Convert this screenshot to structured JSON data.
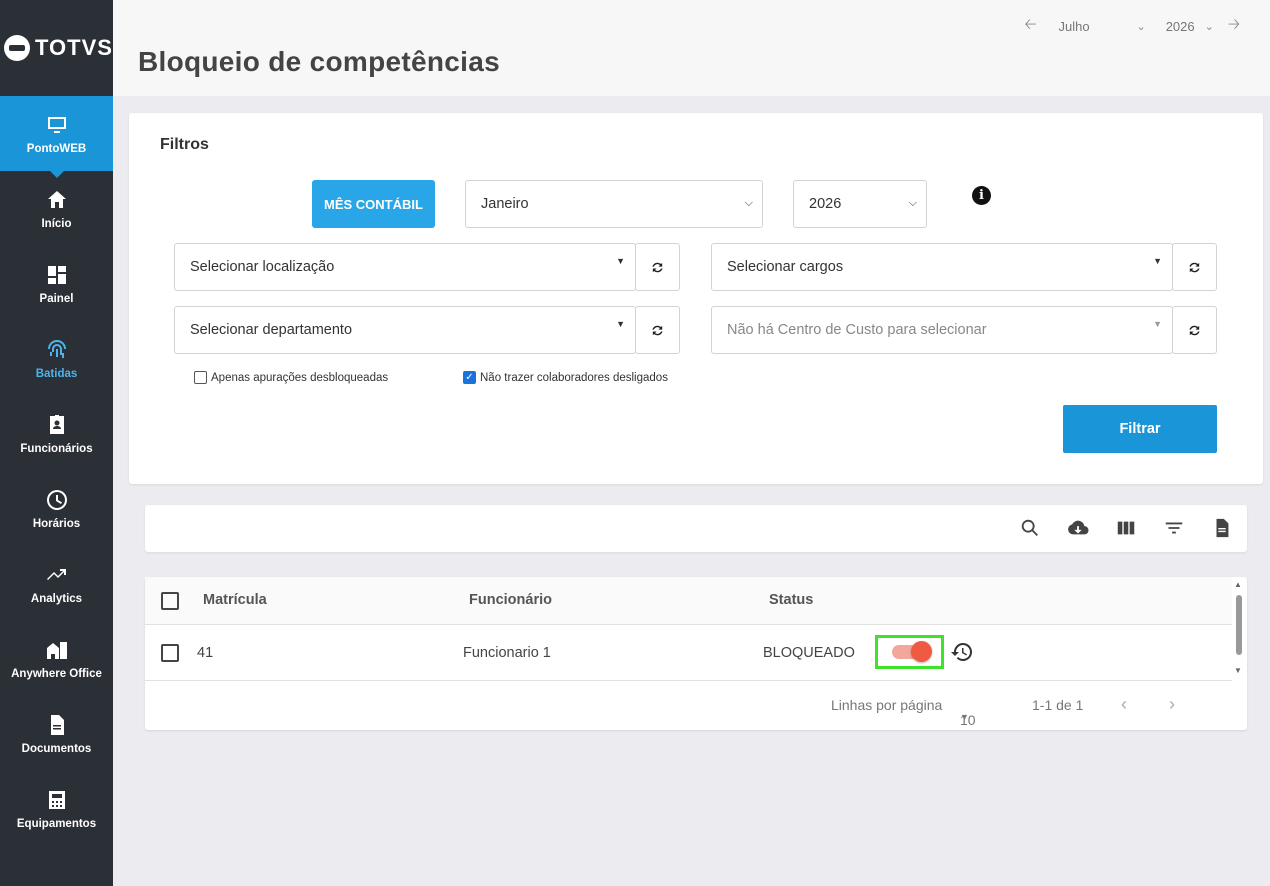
{
  "brand": {
    "name": "TOTVS"
  },
  "sidebar": {
    "items": [
      {
        "label": "PontoWEB",
        "icon": "monitor-icon"
      },
      {
        "label": "Início",
        "icon": "home-icon"
      },
      {
        "label": "Painel",
        "icon": "dashboard-icon"
      },
      {
        "label": "Batidas",
        "icon": "fingerprint-icon"
      },
      {
        "label": "Funcionários",
        "icon": "badge-icon"
      },
      {
        "label": "Horários",
        "icon": "clock-icon"
      },
      {
        "label": "Analytics",
        "icon": "trending-up-icon"
      },
      {
        "label": "Anywhere Office",
        "icon": "building-icon"
      },
      {
        "label": "Documentos",
        "icon": "document-icon"
      },
      {
        "label": "Equipamentos",
        "icon": "device-icon"
      }
    ]
  },
  "header": {
    "title": "Bloqueio de competências",
    "period": {
      "month": "Julho",
      "year": "2026"
    }
  },
  "filters": {
    "title": "Filtros",
    "mes_contabil_label": "MÊS CONTÁBIL",
    "month_value": "Janeiro",
    "year_value": "2026",
    "localizacao_placeholder": "Selecionar localização",
    "cargos_placeholder": "Selecionar cargos",
    "departamento_placeholder": "Selecionar departamento",
    "centro_custo_placeholder": "Não há Centro de Custo para selecionar",
    "checkbox_desbloqueadas": "Apenas apurações desbloqueadas",
    "checkbox_desligados": "Não trazer colaboradores desligados",
    "filtrar_label": "Filtrar"
  },
  "toolbar": {
    "icons": [
      "search-icon",
      "cloud-download-icon",
      "columns-icon",
      "filter-list-icon",
      "file-icon"
    ]
  },
  "table": {
    "headers": {
      "matricula": "Matrícula",
      "funcionario": "Funcionário",
      "status": "Status"
    },
    "rows": [
      {
        "matricula": "41",
        "funcionario": "Funcionario 1",
        "status": "BLOQUEADO",
        "locked": true
      }
    ],
    "footer": {
      "rows_per_page_label": "Linhas por página",
      "rows_per_page": "10",
      "range": "1-1 de 1"
    }
  },
  "colors": {
    "accent": "#1a96d8",
    "toggle_on": "#ef5a43",
    "highlight": "#3ee22a",
    "sidebar": "#2b2f36"
  }
}
